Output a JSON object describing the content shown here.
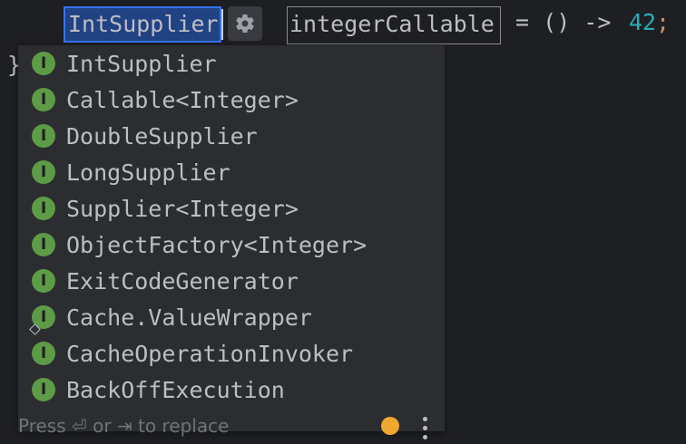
{
  "editor": {
    "type_value": "IntSupplier",
    "variable_name": "integerCallable",
    "assign_part": " = () -> ",
    "literal": "42",
    "semicolon": ";",
    "closing_brace": "}"
  },
  "colors": {
    "background": "#1e1f22",
    "popup_background": "#2b2d30",
    "selection": "#214283",
    "accent_blue": "#3574f0",
    "number": "#2aacb8",
    "keyword_orange": "#cf8e6d",
    "interface_badge": "#5e9b46",
    "indicator_orange": "#f0a732"
  },
  "popup": {
    "items": [
      {
        "label": "IntSupplier",
        "badge": "I"
      },
      {
        "label": "Callable<Integer>",
        "badge": "I"
      },
      {
        "label": "DoubleSupplier",
        "badge": "I"
      },
      {
        "label": "LongSupplier",
        "badge": "I"
      },
      {
        "label": "Supplier<Integer>",
        "badge": "I"
      },
      {
        "label": "ObjectFactory<Integer>",
        "badge": "I"
      },
      {
        "label": "ExitCodeGenerator",
        "badge": "I"
      },
      {
        "label": "Cache.ValueWrapper",
        "badge": "I"
      },
      {
        "label": "CacheOperationInvoker",
        "badge": "I"
      },
      {
        "label": "BackOffExecution",
        "badge": "I"
      }
    ],
    "footer_hint": "Press ⏎ or ⇥ to replace"
  },
  "icons": {
    "settings": "gear-icon",
    "interface": "interface-badge-icon",
    "inner_class_marker": "diamond-icon",
    "more": "vertical-dots-icon",
    "status": "orange-dot-icon"
  }
}
